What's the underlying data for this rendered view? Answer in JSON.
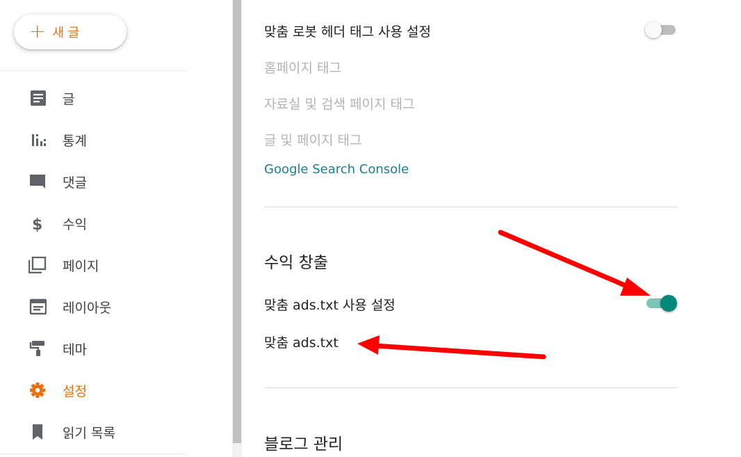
{
  "sidebar": {
    "new_post": {
      "icon": "plus-icon",
      "label": "새 글"
    },
    "items": [
      {
        "label": "글",
        "icon": "posts-icon"
      },
      {
        "label": "통계",
        "icon": "stats-icon"
      },
      {
        "label": "댓글",
        "icon": "comments-icon"
      },
      {
        "label": "수익",
        "icon": "dollar-icon"
      },
      {
        "label": "페이지",
        "icon": "pages-icon"
      },
      {
        "label": "레이아웃",
        "icon": "layout-icon"
      },
      {
        "label": "테마",
        "icon": "theme-paint-roller-icon"
      },
      {
        "label": "설정",
        "icon": "gear-icon",
        "active": true
      },
      {
        "label": "읽기 목록",
        "icon": "bookmark-icon"
      }
    ]
  },
  "crawlers": {
    "custom_robots_header": {
      "label": "맞춤 로봇 헤더 태그 사용 설정",
      "enabled": false
    },
    "homepage_tags": "홈페이지 태그",
    "archive_search_tags": "자료실 및 검색 페이지 태그",
    "post_page_tags": "글 및 페이지 태그",
    "search_console_link": "Google Search Console"
  },
  "monetization": {
    "title": "수익 창출",
    "custom_ads_txt_toggle": {
      "label": "맞춤 ads.txt 사용 설정",
      "enabled": true
    },
    "custom_ads_txt": "맞춤 ads.txt"
  },
  "blog_management": {
    "title": "블로그 관리"
  },
  "colors": {
    "accent": "#e8710a",
    "toggle_on": "#00897b",
    "link": "#1a7f8e",
    "arrow": "#ff0000"
  }
}
